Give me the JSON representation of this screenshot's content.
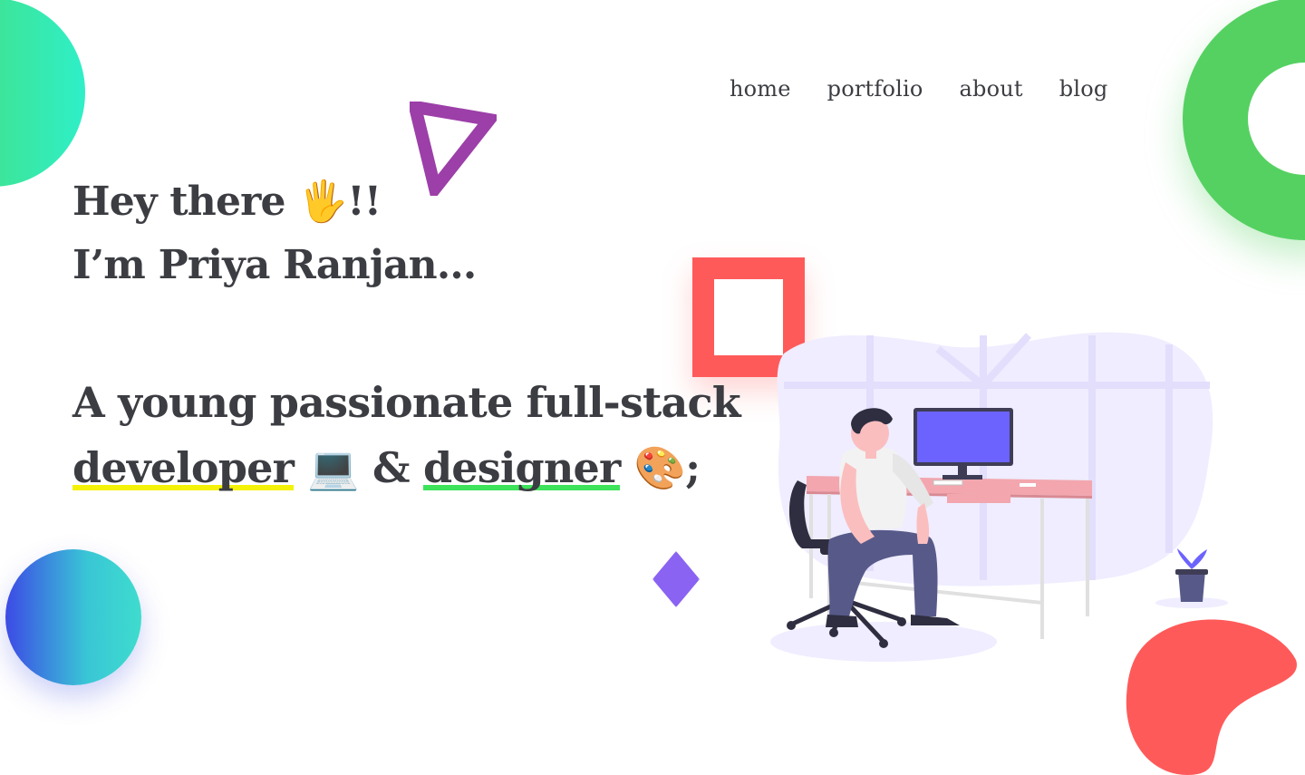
{
  "nav": {
    "items": [
      {
        "label": "home"
      },
      {
        "label": "portfolio"
      },
      {
        "label": "about"
      },
      {
        "label": "blog"
      }
    ]
  },
  "hero": {
    "greeting_prefix": "Hey there ",
    "greeting_emoji": "🖐",
    "greeting_suffix": "!!",
    "intro": "I’m Priya Ranjan...",
    "tagline_line1": "A young passionate full-stack",
    "role_developer": "developer",
    "laptop_emoji": "💻",
    "ampersand": " & ",
    "role_designer": "designer",
    "palette_emoji": "🎨",
    "end_punct": ";"
  },
  "colors": {
    "text": "#3b3d42",
    "green": "#55d162",
    "red": "#ff5a5a",
    "purple": "#9c3fa8",
    "violet": "#8a63f2",
    "highlight_yellow": "#f5f20a",
    "highlight_green": "#3de35a",
    "monitor": "#6c63ff"
  },
  "icons": {
    "greeting": "waving-hand-icon",
    "developer": "laptop-icon",
    "designer": "palette-icon"
  }
}
